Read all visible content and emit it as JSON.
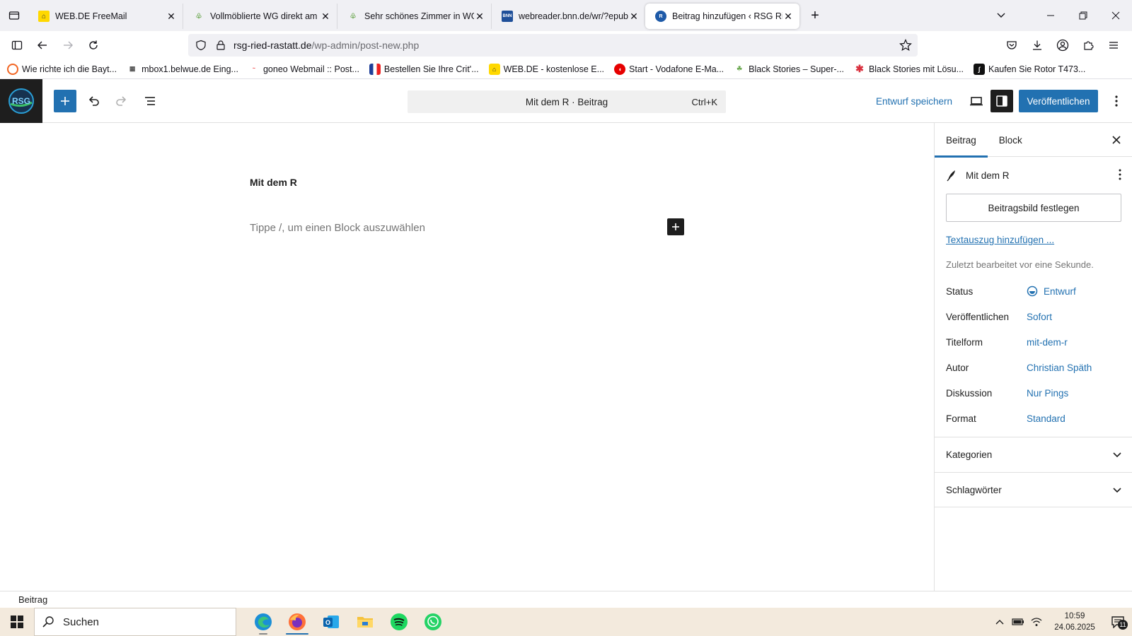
{
  "browser": {
    "tabs": [
      {
        "title": "WEB.DE FreeMail",
        "active": false
      },
      {
        "title": "Vollmöblierte WG direkt am Eur",
        "active": false
      },
      {
        "title": "Sehr schönes Zimmer in WG in",
        "active": false
      },
      {
        "title": "webreader.bnn.de/wr/?epub=ht",
        "active": false
      },
      {
        "title": "Beitrag hinzufügen ‹ RSG Ried R",
        "active": true
      }
    ],
    "url": {
      "host": "rsg-ried-rastatt.de",
      "path": "/wp-admin/post-new.php"
    },
    "bookmarks": [
      "Wie richte ich die Bayt...",
      "mbox1.belwue.de Eing...",
      "goneo Webmail :: Post...",
      "Bestellen Sie Ihre Crit'...",
      "WEB.DE - kostenlose E...",
      "Start - Vodafone E-Ma...",
      "Black Stories – Super-...",
      "Black Stories mit Lösu...",
      "Kaufen Sie Rotor T473..."
    ]
  },
  "wp": {
    "logo_text": "RSG",
    "command_bar": {
      "label": "Mit dem R · Beitrag",
      "shortcut": "Ctrl+K"
    },
    "save_draft": "Entwurf speichern",
    "publish": "Veröffentlichen",
    "editor": {
      "title": "Mit dem R",
      "placeholder": "Tippe /, um einen Block auszuwählen"
    },
    "sidebar": {
      "tabs": [
        "Beitrag",
        "Block"
      ],
      "post_title": "Mit dem R",
      "featured_image_button": "Beitragsbild festlegen",
      "excerpt_link": "Textauszug hinzufügen ...",
      "last_edited": "Zuletzt bearbeitet vor eine Sekunde.",
      "meta": [
        {
          "label": "Status",
          "value": "Entwurf"
        },
        {
          "label": "Veröffentlichen",
          "value": "Sofort"
        },
        {
          "label": "Titelform",
          "value": "mit-dem-r"
        },
        {
          "label": "Autor",
          "value": "Christian Späth"
        },
        {
          "label": "Diskussion",
          "value": "Nur Pings"
        },
        {
          "label": "Format",
          "value": "Standard"
        }
      ],
      "panels": [
        "Kategorien",
        "Schlagwörter"
      ]
    },
    "breadcrumb": "Beitrag"
  },
  "taskbar": {
    "search_label": "Suchen",
    "time": "10:59",
    "date": "24.06.2025",
    "notification_count": "11"
  },
  "colors": {
    "wp_blue": "#2271b1",
    "dark": "#1e1e1e",
    "taskbar": "#f3eadd"
  }
}
